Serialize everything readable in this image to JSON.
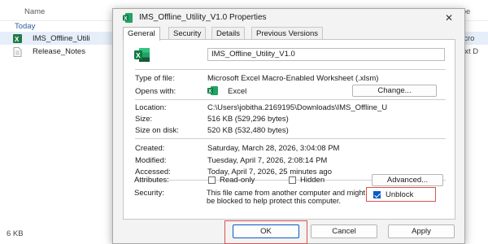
{
  "explorer": {
    "col_name": "Name",
    "col_type": "ype",
    "group": "Today",
    "rows": [
      {
        "name": "IMS_Offline_Utili",
        "type": "licro"
      },
      {
        "name": "Release_Notes",
        "type": "ext D"
      }
    ],
    "status": "6 KB"
  },
  "dialog": {
    "title": "IMS_Offline_Utility_V1.0 Properties",
    "close": "✕",
    "tabs": [
      "General",
      "Security",
      "Details",
      "Previous Versions"
    ],
    "file_name": "IMS_Offline_Utility_V1.0",
    "type_label": "Type of file:",
    "type_value": "Microsoft Excel Macro-Enabled Worksheet (.xlsm)",
    "opens_label": "Opens with:",
    "opens_value": "Excel",
    "change_button": "Change...",
    "location_label": "Location:",
    "location_value": "C:\\Users\\jobitha.2169195\\Downloads\\IMS_Offline_U",
    "size_label": "Size:",
    "size_value": "516 KB (529,296 bytes)",
    "size_disk_label": "Size on disk:",
    "size_disk_value": "520 KB (532,480 bytes)",
    "created_label": "Created:",
    "created_value": "Saturday, March 28, 2026, 3:04:08 PM",
    "modified_label": "Modified:",
    "modified_value": "Tuesday, April 7, 2026, 2:08:14 PM",
    "accessed_label": "Accessed:",
    "accessed_value": "Today, April 7, 2026, 25 minutes ago",
    "attributes_label": "Attributes:",
    "readonly_label": "Read-only",
    "hidden_label": "Hidden",
    "advanced_button": "Advanced...",
    "security_label": "Security:",
    "security_text": "This file came from another computer and might be blocked to help protect this computer.",
    "unblock_label": "Unblock",
    "unblock_checked": true,
    "ok_button": "OK",
    "cancel_button": "Cancel",
    "apply_button": "Apply"
  },
  "colors": {
    "excel_green": "#1e7a45",
    "highlight_red": "#d9534f",
    "checkbox_blue": "#0b5cc5"
  }
}
